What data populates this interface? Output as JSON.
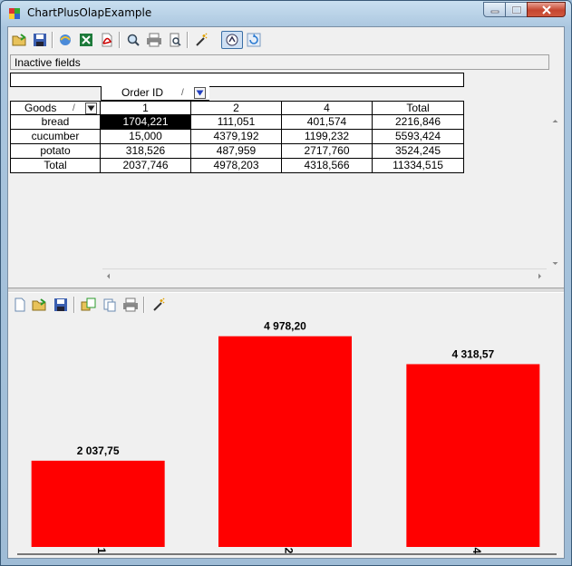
{
  "window": {
    "title": "ChartPlusOlapExample"
  },
  "pivot_toolbar": {
    "icons": [
      "open-icon",
      "save-icon",
      "export-html-icon",
      "export-excel-icon",
      "export-pdf-icon",
      "zoom-icon",
      "print-icon",
      "print-preview-icon",
      "wizard-icon",
      "chart-toggle-icon",
      "refresh-icon"
    ]
  },
  "chart_toolbar": {
    "icons": [
      "new-icon",
      "open-icon",
      "save-icon",
      "copy-icon",
      "paste-icon",
      "print-icon",
      "wizard-icon"
    ]
  },
  "inactive_fields": {
    "label": "Inactive fields"
  },
  "pivot": {
    "column_field": "Order ID",
    "row_field": "Goods",
    "column_headers": [
      "1",
      "2",
      "4",
      "Total"
    ],
    "rows": [
      {
        "label": "bread",
        "cells": [
          "1704,221",
          "111,051",
          "401,574",
          "2216,846"
        ]
      },
      {
        "label": "cucumber",
        "cells": [
          "15,000",
          "4379,192",
          "1199,232",
          "5593,424"
        ]
      },
      {
        "label": "potato",
        "cells": [
          "318,526",
          "487,959",
          "2717,760",
          "3524,245"
        ]
      },
      {
        "label": "Total",
        "cells": [
          "2037,746",
          "4978,203",
          "4318,566",
          "11334,515"
        ]
      }
    ],
    "sort_mark": "/"
  },
  "chart_data": {
    "type": "bar",
    "categories": [
      "1",
      "2",
      "4"
    ],
    "values": [
      2037.746,
      4978.203,
      4318.566
    ],
    "data_labels": [
      "2 037,75",
      "4 978,20",
      "4 318,57"
    ],
    "ylim": [
      0,
      5400
    ],
    "bar_color": "#ff0000",
    "grid": false
  },
  "colors": {
    "selected_cell_bg": "#000000",
    "selected_cell_fg": "#ffffff",
    "bar": "#ff0000",
    "close_button": "#c5462f"
  }
}
